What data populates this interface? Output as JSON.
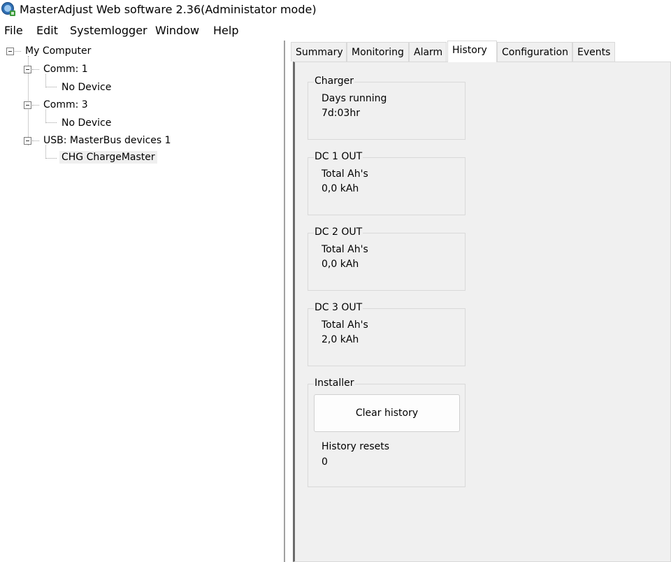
{
  "window": {
    "title": "MasterAdjust Web software 2.36(Administator mode)",
    "icon": "masteradjust-app-icon"
  },
  "menu": [
    "File",
    "Edit",
    "Systemlogger",
    "Window",
    "Help"
  ],
  "tree": {
    "root": "My Computer",
    "comm1": "Comm: 1",
    "comm1_child": "No Device",
    "comm3": "Comm: 3",
    "comm3_child": "No Device",
    "usb": "USB: MasterBus devices 1",
    "usb_child": "CHG ChargeMaster"
  },
  "tabs": [
    "Summary",
    "Monitoring",
    "Alarm",
    "History",
    "Configuration",
    "Events"
  ],
  "active_tab": "History",
  "history": {
    "charger": {
      "title": "Charger",
      "label": "Days running",
      "value": "7d:03hr"
    },
    "dc1": {
      "title": "DC 1 OUT",
      "label": "Total Ah's",
      "value": "0,0 kAh"
    },
    "dc2": {
      "title": "DC 2 OUT",
      "label": "Total Ah's",
      "value": "0,0 kAh"
    },
    "dc3": {
      "title": "DC 3 OUT",
      "label": "Total Ah's",
      "value": "2,0 kAh"
    },
    "installer": {
      "title": "Installer",
      "clear_button": "Clear history",
      "resets_label": "History resets",
      "resets_value": "0"
    }
  },
  "colors": {
    "panel_bg": "#f0f0f0",
    "selected_bg": "#efefef",
    "border": "#d9d9d9"
  }
}
